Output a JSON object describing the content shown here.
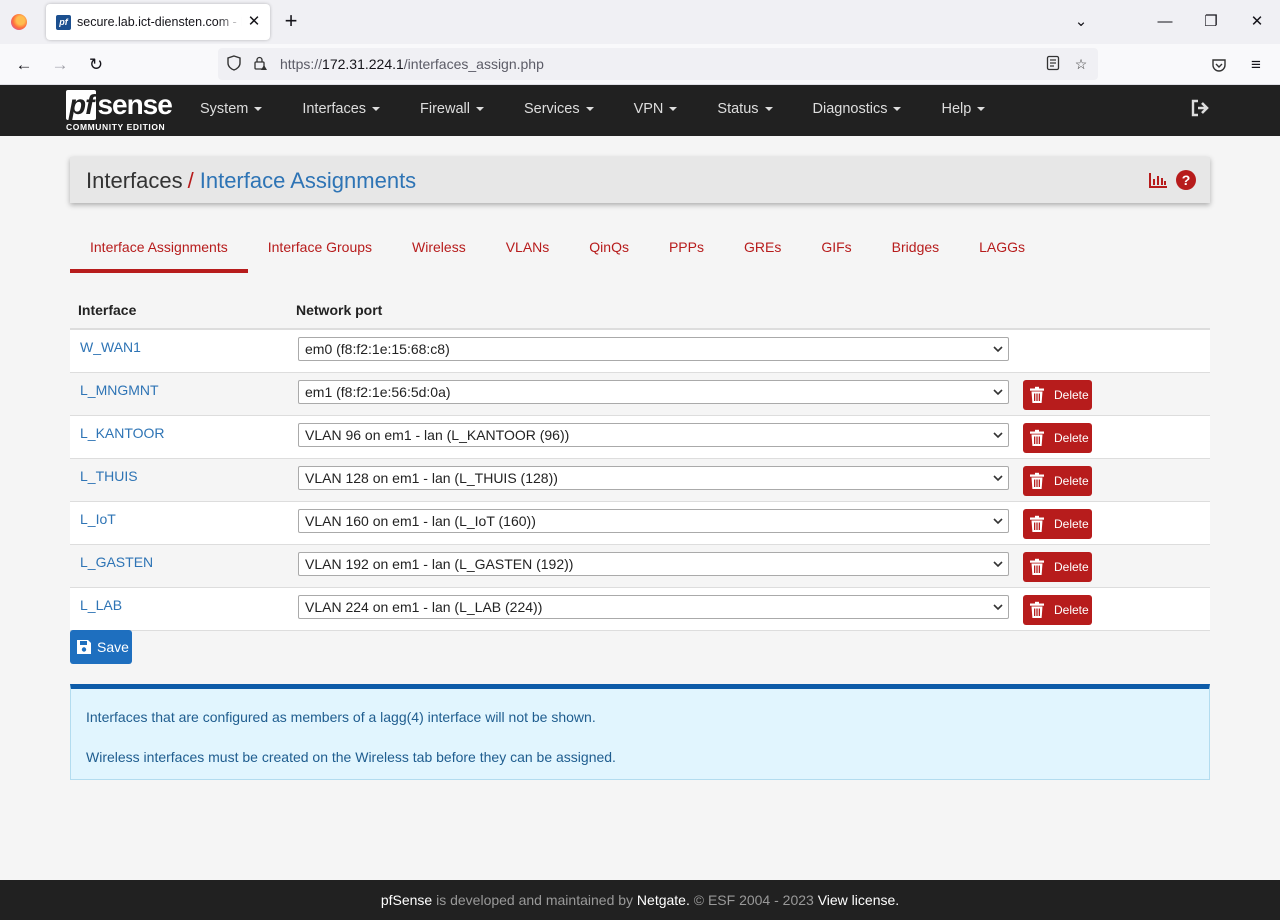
{
  "browser": {
    "tab_title": "secure.lab.ict-diensten.com - Interfaces: Interface Assignments",
    "tab_favicon": "pf",
    "url_prefix": "https://",
    "url_host": "172.31.224.1",
    "url_path": "/interfaces_assign.php"
  },
  "brand": {
    "logo_pf": "pf",
    "logo_sense": "sense",
    "logo_sub": "COMMUNITY EDITION"
  },
  "menu": [
    "System",
    "Interfaces",
    "Firewall",
    "Services",
    "VPN",
    "Status",
    "Diagnostics",
    "Help"
  ],
  "breadcrumb": {
    "parent": "Interfaces",
    "separator": "/",
    "current": "Interface Assignments"
  },
  "tabs": [
    "Interface Assignments",
    "Interface Groups",
    "Wireless",
    "VLANs",
    "QinQs",
    "PPPs",
    "GREs",
    "GIFs",
    "Bridges",
    "LAGGs"
  ],
  "active_tab": "Interface Assignments",
  "table": {
    "headers": [
      "Interface",
      "Network port"
    ],
    "rows": [
      {
        "interface": "W_WAN1",
        "port": "em0 (f8:f2:1e:15:68:c8)",
        "deletable": false
      },
      {
        "interface": "L_MNGMNT",
        "port": "em1 (f8:f2:1e:56:5d:0a)",
        "deletable": true
      },
      {
        "interface": "L_KANTOOR",
        "port": "VLAN 96 on em1 - lan (L_KANTOOR (96))",
        "deletable": true
      },
      {
        "interface": "L_THUIS",
        "port": "VLAN 128 on em1 - lan (L_THUIS (128))",
        "deletable": true
      },
      {
        "interface": "L_IoT",
        "port": "VLAN 160 on em1 - lan (L_IoT (160))",
        "deletable": true
      },
      {
        "interface": "L_GASTEN",
        "port": "VLAN 192 on em1 - lan (L_GASTEN (192))",
        "deletable": true
      },
      {
        "interface": "L_LAB",
        "port": "VLAN 224 on em1 - lan (L_LAB (224))",
        "deletable": true
      }
    ],
    "delete_label": "Delete"
  },
  "save_label": "Save",
  "info": {
    "line1": "Interfaces that are configured as members of a lagg(4) interface will not be shown.",
    "line2": "Wireless interfaces must be created on the Wireless tab before they can be assigned."
  },
  "footer": {
    "brand": "pfSense",
    "text1": " is developed and maintained by ",
    "company": "Netgate.",
    "text2": " © ESF 2004 - 2023 ",
    "license": "View license."
  },
  "colors": {
    "accent_red": "#b71c1c",
    "link_blue": "#2e74b5",
    "header_dark": "#212121",
    "info_border": "#0d5ba8"
  },
  "icons": {
    "firefox": "firefox-logo-icon",
    "tab_close": "close-icon",
    "new_tab": "plus-icon",
    "chart": "bar-chart-icon",
    "help": "help-circle-icon",
    "delete": "trash-icon",
    "save": "floppy-disk-icon",
    "logout": "sign-out-icon"
  }
}
